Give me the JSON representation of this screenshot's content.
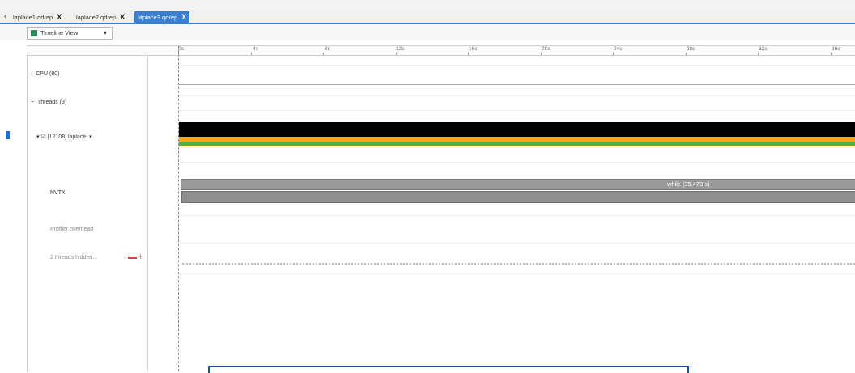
{
  "tabs": [
    {
      "label": "laplace1.qdrep",
      "close": "X"
    },
    {
      "label": "laplace2.qdrep",
      "close": "X"
    },
    {
      "label": "laplace3.qdrep",
      "close": "X",
      "active": true
    }
  ],
  "view_select": {
    "label": "Timeline View",
    "arrow": "▾"
  },
  "ruler_ticks": [
    "0s",
    "4s",
    "8s",
    "12s",
    "16s",
    "20s",
    "24s",
    "28s",
    "32s",
    "36s"
  ],
  "rows": {
    "cpu": {
      "arrow": "›",
      "label": "CPU (80)"
    },
    "threads": {
      "arrow": "−",
      "label": "Threads (3)"
    },
    "laplace": {
      "arrow": "▾",
      "check": "☑",
      "label": "[12108] laplace",
      "dropdown": "▾"
    },
    "nvtx": {
      "label": "NVTX"
    },
    "overhead": {
      "label": "Profiler overhead"
    },
    "hidden": {
      "label": "2 threads hidden..."
    }
  },
  "nvtx_range": {
    "label": "while [35.470 s]"
  },
  "colors": {
    "accent": "#3b7fd3",
    "cpu_util": "#000000",
    "thread_orange": "#f6a623",
    "thread_green": "#4caf50",
    "nvtx": "#9a9a9a"
  }
}
